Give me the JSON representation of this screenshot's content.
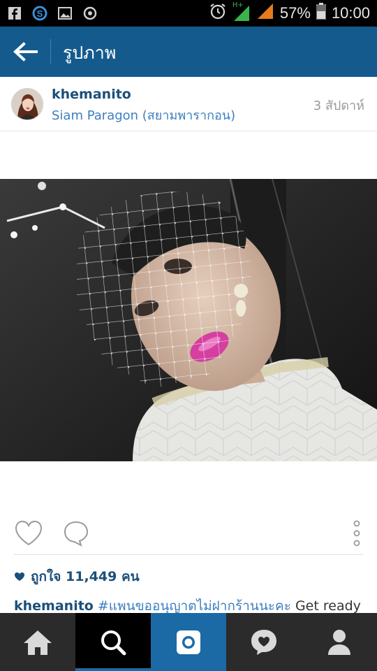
{
  "status_bar": {
    "battery": "57%",
    "time": "10:00",
    "network_label": "H+"
  },
  "header": {
    "title": "รูปภาพ"
  },
  "post": {
    "username": "khemanito",
    "location": "Siam Paragon (สยามพารากอน)",
    "time_ago": "3 สัปดาห์",
    "likes": "ถูกใจ 11,449 คน",
    "caption_user": "khemanito",
    "caption_hashtag": "#แพนขออนุญาตไม่ฝากร้านนะคะ",
    "caption_text": " Get ready"
  },
  "colors": {
    "header_bg": "#145a8d",
    "accent": "#1b6aa5",
    "link": "#3d7fbf",
    "nav_bg": "#2b2b2b"
  },
  "nav": {
    "items": [
      "home-icon",
      "search-icon",
      "camera-icon",
      "activity-icon",
      "profile-icon"
    ],
    "active": "search-icon"
  }
}
